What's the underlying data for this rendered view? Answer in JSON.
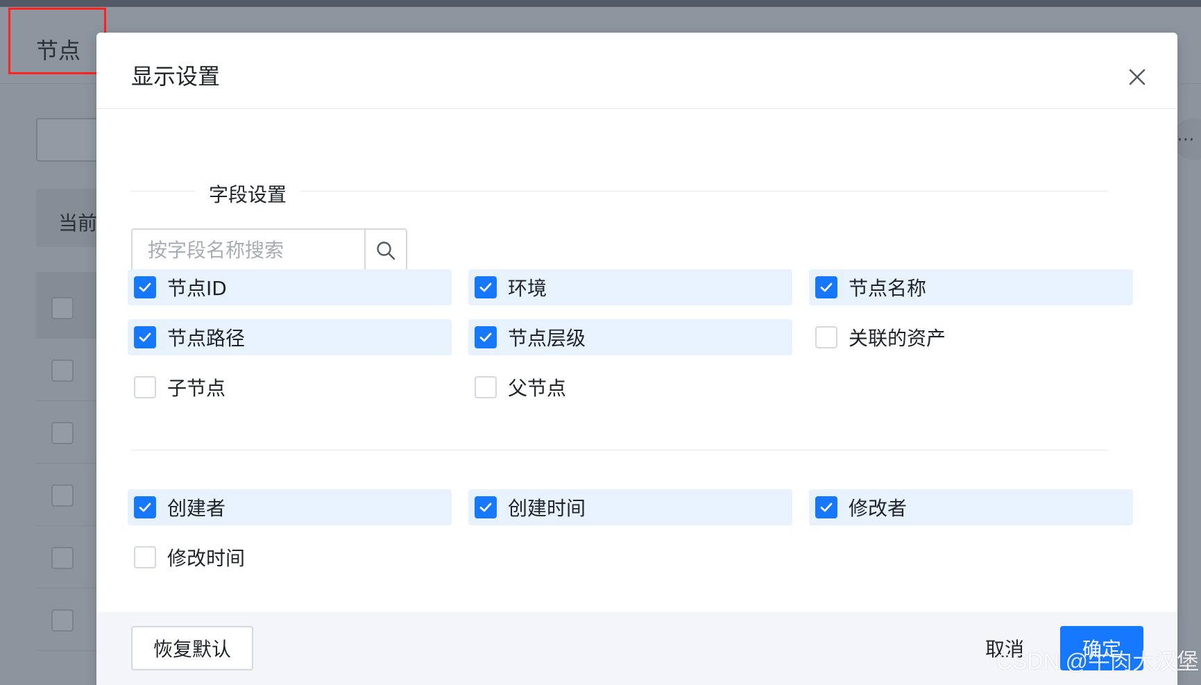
{
  "background": {
    "page_title": "节点",
    "filter_label": "当前",
    "more_icon": "⋯"
  },
  "modal": {
    "title": "显示设置",
    "close_icon": "close-icon",
    "section_title": "字段设置",
    "search": {
      "placeholder": "按字段名称搜索",
      "value": ""
    },
    "group1": [
      {
        "label": "节点ID",
        "checked": true
      },
      {
        "label": "环境",
        "checked": true
      },
      {
        "label": "节点名称",
        "checked": true
      },
      {
        "label": "节点路径",
        "checked": true
      },
      {
        "label": "节点层级",
        "checked": true
      },
      {
        "label": "关联的资产",
        "checked": false
      },
      {
        "label": "子节点",
        "checked": false
      },
      {
        "label": "父节点",
        "checked": false
      }
    ],
    "group2": [
      {
        "label": "创建者",
        "checked": true
      },
      {
        "label": "创建时间",
        "checked": true
      },
      {
        "label": "修改者",
        "checked": true
      },
      {
        "label": "修改时间",
        "checked": false
      }
    ],
    "footer": {
      "reset_label": "恢复默认",
      "cancel_label": "取消",
      "ok_label": "确定"
    }
  },
  "watermark": "CSDN @牛肉大汉堡",
  "colors": {
    "primary": "#1677ff",
    "checked_bg": "#e8f2fd",
    "highlight_box": "#ff2020"
  }
}
